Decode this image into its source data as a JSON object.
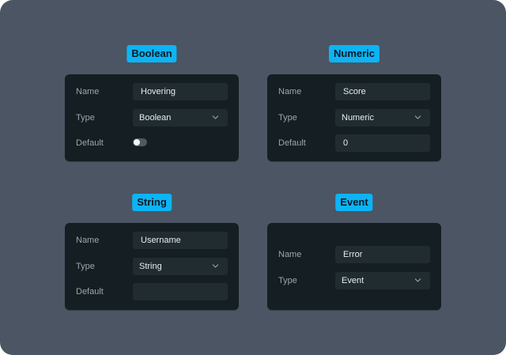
{
  "colors": {
    "canvas": "#4b5563",
    "panel": "#151e22",
    "field": "#212c31",
    "badge": "#0cb4f5",
    "label_text": "#9aa7ad",
    "value_text": "#e6ecee"
  },
  "cards": {
    "boolean": {
      "badge": "Boolean",
      "name_label": "Name",
      "name_value": "Hovering",
      "type_label": "Type",
      "type_value": "Boolean",
      "default_label": "Default",
      "default_toggle": false,
      "chevron_icon": "chevron-down-icon"
    },
    "numeric": {
      "badge": "Numeric",
      "name_label": "Name",
      "name_value": "Score",
      "type_label": "Type",
      "type_value": "Numeric",
      "default_label": "Default",
      "default_value": "0",
      "chevron_icon": "chevron-down-icon"
    },
    "string": {
      "badge": "String",
      "name_label": "Name",
      "name_value": "Username",
      "type_label": "Type",
      "type_value": "String",
      "default_label": "Default",
      "default_value": "",
      "chevron_icon": "chevron-down-icon"
    },
    "event": {
      "badge": "Event",
      "name_label": "Name",
      "name_value": "Error",
      "type_label": "Type",
      "type_value": "Event",
      "chevron_icon": "chevron-down-icon"
    }
  }
}
